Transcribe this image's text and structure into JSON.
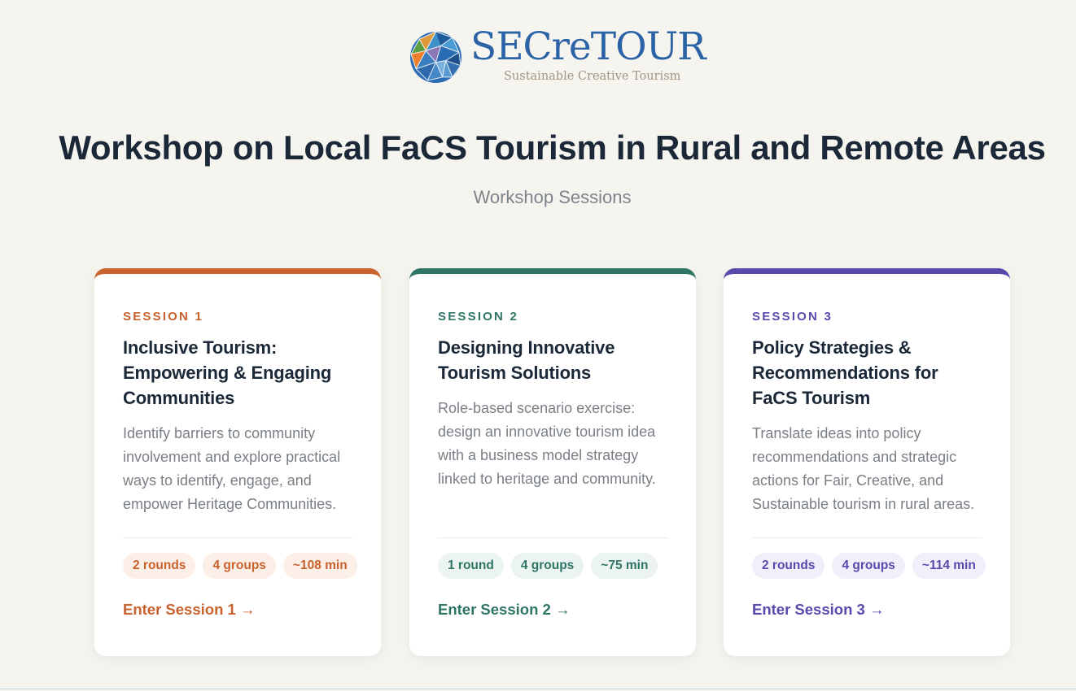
{
  "header": {
    "brand": "SECreTOUR",
    "tagline": "Sustainable Creative Tourism",
    "title": "Workshop on Local FaCS Tourism in Rural and Remote Areas",
    "subtitle": "Workshop Sessions"
  },
  "sessions": [
    {
      "label": "SESSION 1",
      "title": "Inclusive Tourism: Empowering & Engaging Communities",
      "description": "Identify barriers to community involvement and explore practical ways to identify, engage, and empower Heritage Communities.",
      "tags": [
        "2 rounds",
        "4 groups",
        "~108 min"
      ],
      "link": "Enter Session 1 →",
      "color": "#c9612c",
      "tag_bg": "#fcefe8"
    },
    {
      "label": "SESSION 2",
      "title": "Designing Innovative Tourism Solutions",
      "description": "Role-based scenario exercise: design an innovative tourism idea with a business model strategy linked to heritage and community.",
      "tags": [
        "1 round",
        "4 groups",
        "~75 min"
      ],
      "link": "Enter Session 2 →",
      "color": "#2e7566",
      "tag_bg": "#ebf4f1"
    },
    {
      "label": "SESSION 3",
      "title": "Policy Strategies & Recommendations for FaCS Tourism",
      "description": "Translate ideas into policy recommendations and strategic actions for Fair, Creative, and Sustainable tourism in rural areas.",
      "tags": [
        "2 rounds",
        "4 groups",
        "~114 min"
      ],
      "link": "Enter Session 3 →",
      "color": "#5b48ad",
      "tag_bg": "#f1effa"
    }
  ]
}
